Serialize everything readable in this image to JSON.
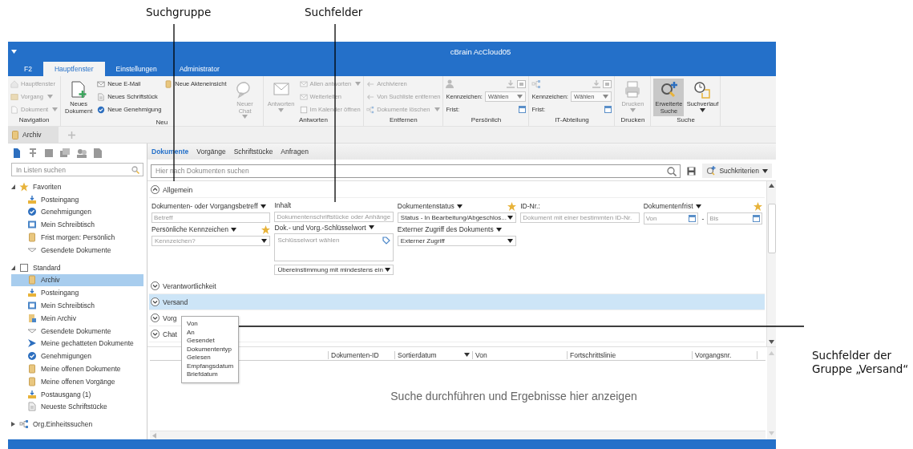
{
  "annotations": [
    {
      "text": "Suchgruppe"
    },
    {
      "text": "Suchfelder"
    },
    {
      "text": "Suchfelder der Gruppe „Versand“"
    }
  ],
  "window": {
    "title": "cBrain AcCloud05"
  },
  "tabs": [
    {
      "label": "F2",
      "selected": false
    },
    {
      "label": "Hauptfenster",
      "selected": true
    },
    {
      "label": "Einstellungen",
      "selected": false
    },
    {
      "label": "Administrator",
      "selected": false
    }
  ],
  "ribbon": {
    "groups": [
      {
        "label": "Navigation",
        "items": [
          {
            "kind": "small",
            "label": "Hauptfenster",
            "menu": false,
            "disabled": true
          },
          {
            "kind": "small",
            "label": "Vorgang",
            "menu": true,
            "disabled": true
          },
          {
            "kind": "small",
            "label": "Dokument",
            "menu": true,
            "disabled": true
          }
        ]
      },
      {
        "label": "Neu",
        "items": [
          {
            "kind": "large",
            "label": "Neues Dokument",
            "menu": false,
            "disabled": false
          },
          {
            "kind": "small",
            "label": "Neue E-Mail",
            "menu": false,
            "disabled": false
          },
          {
            "kind": "small",
            "label": "Neues Schriftstück",
            "menu": false,
            "disabled": false
          },
          {
            "kind": "small",
            "label": "Neue Genehmigung",
            "menu": false,
            "disabled": false
          },
          {
            "kind": "small",
            "label": "Neue Akteneinsicht",
            "menu": false,
            "disabled": false
          },
          {
            "kind": "large",
            "label": "Neuer Chat",
            "menu": true,
            "disabled": true
          }
        ]
      },
      {
        "label": "Antworten",
        "items": [
          {
            "kind": "large",
            "label": "Antworten",
            "menu": true,
            "disabled": true
          },
          {
            "kind": "small",
            "label": "Allen antworten",
            "menu": true,
            "disabled": true
          },
          {
            "kind": "small",
            "label": "Weiterleiten",
            "menu": false,
            "disabled": true
          },
          {
            "kind": "small",
            "label": "Im Kalender öffnen",
            "menu": false,
            "disabled": true
          }
        ]
      },
      {
        "label": "Entfernen",
        "items": [
          {
            "kind": "small",
            "label": "Archivieren",
            "menu": false,
            "disabled": true
          },
          {
            "kind": "small",
            "label": "Von Suchliste entfernen",
            "menu": false,
            "disabled": true
          },
          {
            "kind": "small",
            "label": "Dokumente löschen",
            "menu": true,
            "disabled": true
          }
        ]
      },
      {
        "label": "Persönlich",
        "items": [
          {
            "kind": "personal-filter",
            "mark_label": "Kennzeichen:",
            "select": "Wählen",
            "deadline_label": "Frist:",
            "disabled": false
          }
        ]
      },
      {
        "label": "IT-Abteilung",
        "items": [
          {
            "kind": "unit-filter",
            "mark_label": "Kennzeichen:",
            "select": "Wählen",
            "deadline_label": "Frist:",
            "disabled": false
          }
        ]
      },
      {
        "label": "Drucken",
        "items": [
          {
            "kind": "large",
            "label": "Drucken",
            "menu": true,
            "disabled": true
          }
        ]
      },
      {
        "label": "Suche",
        "items": [
          {
            "kind": "large",
            "label": "Erweiterte Suche",
            "menu": false,
            "disabled": false,
            "pressed": true
          },
          {
            "kind": "large",
            "label": "Suchverlauf",
            "menu": true,
            "disabled": false,
            "pressed": false
          }
        ]
      }
    ]
  },
  "doc_tabs": [
    {
      "label": "Archiv",
      "selected": true
    }
  ],
  "sidebar": {
    "search": {
      "placeholder": "In Listen suchen"
    },
    "tree": [
      {
        "label": "Favoriten",
        "expanded": true,
        "selected": false,
        "children": [
          {
            "label": "Posteingang",
            "selected": false
          },
          {
            "label": "Genehmigungen",
            "selected": false
          },
          {
            "label": "Mein Schreibtisch",
            "selected": false
          },
          {
            "label": "Frist morgen: Persönlich",
            "selected": false
          },
          {
            "label": "Gesendete Dokumente",
            "selected": false
          }
        ]
      },
      {
        "label": "Standard",
        "expanded": true,
        "selected": false,
        "children": [
          {
            "label": "Archiv",
            "selected": true
          },
          {
            "label": "Posteingang",
            "selected": false
          },
          {
            "label": "Mein Schreibtisch",
            "selected": false
          },
          {
            "label": "Mein Archiv",
            "selected": false
          },
          {
            "label": "Gesendete Dokumente",
            "selected": false
          },
          {
            "label": "Meine gechatteten Dokumente",
            "selected": false
          },
          {
            "label": "Genehmigungen",
            "selected": false
          },
          {
            "label": "Meine offenen Dokumente",
            "selected": false
          },
          {
            "label": "Meine offenen Vorgänge",
            "selected": false
          },
          {
            "label": "Postausgang (1)",
            "selected": false
          },
          {
            "label": "Neueste Schriftstücke",
            "selected": false
          }
        ]
      },
      {
        "label": "Org.Einheitssuchen",
        "expanded": false,
        "selected": false
      }
    ]
  },
  "subtabs": [
    {
      "label": "Dokumente",
      "selected": true
    },
    {
      "label": "Vorgänge",
      "selected": false
    },
    {
      "label": "Schriftstücke",
      "selected": false
    },
    {
      "label": "Anfragen",
      "selected": false
    }
  ],
  "search": {
    "placeholder": "Hier nach Dokumenten suchen",
    "criteria_button": "Suchkriterien"
  },
  "sections": [
    {
      "label": "Allgemein",
      "expanded": true,
      "selected": false,
      "columns": [
        [
          {
            "label": "Dokumenten- oder Vorgangsbetreff",
            "menu": true,
            "starred": false,
            "kind": "text",
            "placeholder": "Betreff"
          },
          {
            "label": "Persönliche Kennzeichen",
            "menu": true,
            "starred": true,
            "kind": "select",
            "placeholder": "Kennzeichen?"
          }
        ],
        [
          {
            "label": "Inhalt",
            "menu": false,
            "starred": false,
            "kind": "text",
            "placeholder": "Dokumentenschriftstücke oder Anhänge"
          },
          {
            "label": "Dok.- und Vorg.-Schlüsselwort",
            "menu": true,
            "starred": false,
            "kind": "keyword",
            "placeholder": "Schlüsselwort wählen",
            "match": "Übereinstimmung mit mindestens ein"
          }
        ],
        [
          {
            "label": "Dokumentenstatus",
            "menu": true,
            "starred": true,
            "kind": "select",
            "value": "Status - In Bearbeitung/Abgeschlos..."
          },
          {
            "label": "Externer Zugriff des Dokuments",
            "menu": true,
            "starred": false,
            "kind": "select",
            "value": "Externer Zugriff"
          }
        ],
        [
          {
            "label": "ID-Nr.:",
            "menu": false,
            "starred": false,
            "kind": "text",
            "placeholder": "Dokument mit einer bestimmten ID-Nr."
          }
        ],
        [
          {
            "label": "Dokumentenfrist",
            "menu": true,
            "starred": true,
            "kind": "daterange",
            "from": "Von",
            "to": "Bis",
            "separator": "-"
          }
        ]
      ]
    },
    {
      "label": "Verantwortlichkeit",
      "expanded": false,
      "selected": false
    },
    {
      "label": "Versand",
      "expanded": false,
      "selected": true
    },
    {
      "label": "Vorg",
      "expanded": false,
      "selected": false
    },
    {
      "label": "Chat",
      "expanded": false,
      "selected": false
    }
  ],
  "popup": {
    "items": [
      "Von",
      "An",
      "Gesendet",
      "Dokumententyp",
      "Gelesen",
      "Empfangsdatum",
      "Briefdatum"
    ]
  },
  "results": {
    "columns": [
      {
        "label": "Dokumenten-ID",
        "sorted": false
      },
      {
        "label": "Sortierdatum",
        "sorted": true
      },
      {
        "label": "Von",
        "sorted": false
      },
      {
        "label": "Fortschrittslinie",
        "sorted": false
      },
      {
        "label": "Vorgangsnr.",
        "sorted": false
      }
    ],
    "empty_message": "Suche durchführen und Ergebnisse hier anzeigen"
  }
}
